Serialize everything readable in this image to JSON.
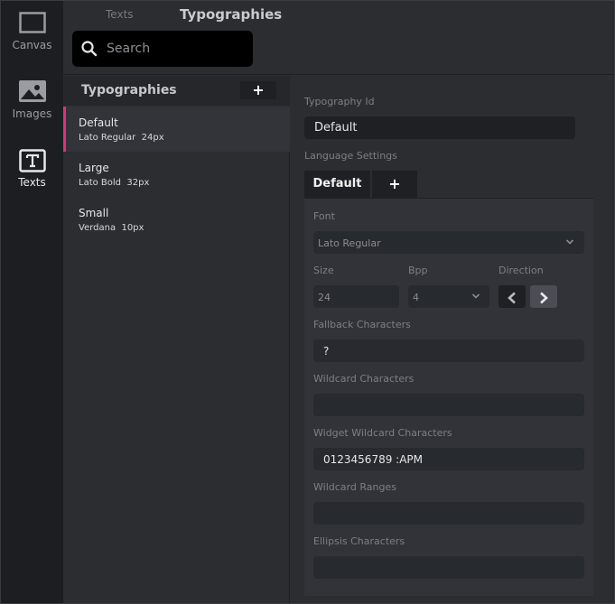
{
  "rail": {
    "items": [
      {
        "label": "Canvas",
        "icon": "canvas-icon"
      },
      {
        "label": "Images",
        "icon": "image-icon"
      },
      {
        "label": "Texts",
        "icon": "text-icon"
      }
    ]
  },
  "header": {
    "crumb_texts": "Texts",
    "title": "Typographies"
  },
  "search": {
    "placeholder": "Search"
  },
  "list": {
    "title": "Typographies",
    "add_label": "+",
    "items": [
      {
        "name": "Default",
        "meta": "Lato Regular  24px"
      },
      {
        "name": "Large",
        "meta": "Lato Bold  32px"
      },
      {
        "name": "Small",
        "meta": "Verdana  10px"
      }
    ]
  },
  "detail": {
    "typography_id_label": "Typography Id",
    "typography_id_value": "Default",
    "language_settings_label": "Language Settings",
    "lang_tab_default": "Default",
    "lang_tab_add": "+",
    "font_label": "Font",
    "font_value": "Lato Regular",
    "size_label": "Size",
    "size_value": "24",
    "bpp_label": "Bpp",
    "bpp_value": "4",
    "direction_label": "Direction",
    "fallback_label": "Fallback Characters",
    "fallback_value": "?",
    "wildcard_label": "Wildcard Characters",
    "wildcard_value": "",
    "widget_wildcard_label": "Widget Wildcard Characters",
    "widget_wildcard_value": "0123456789 :APM",
    "wildcard_ranges_label": "Wildcard Ranges",
    "wildcard_ranges_value": "",
    "ellipsis_label": "Ellipsis Characters",
    "ellipsis_value": ""
  },
  "colors": {
    "accent": "#e0307a",
    "background": "#2b2d31",
    "rail": "#1d1e21",
    "field": "#272a2e"
  }
}
